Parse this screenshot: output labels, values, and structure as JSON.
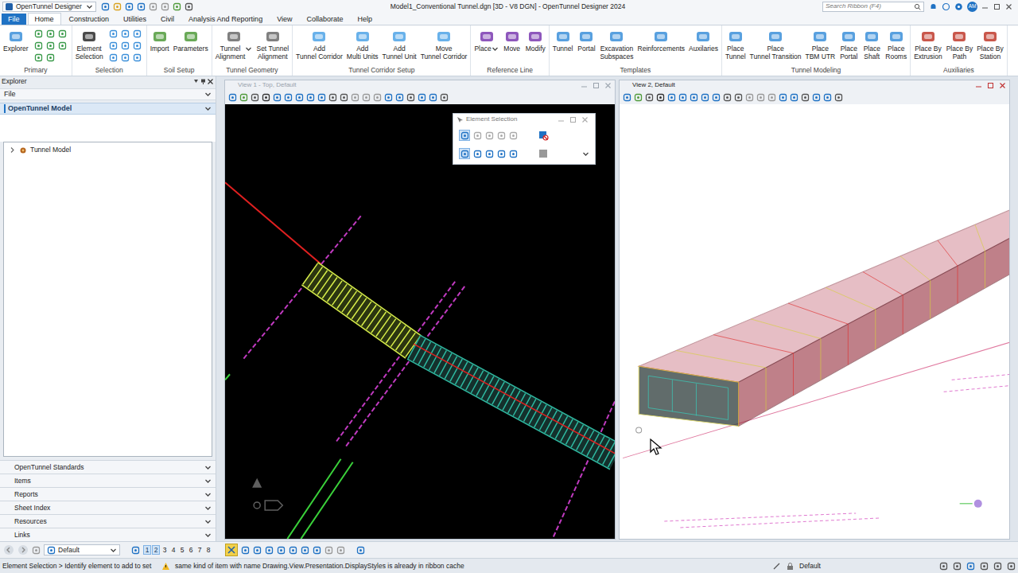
{
  "app": {
    "name": "OpenTunnel Designer",
    "title": "Model1_Conventional Tunnel.dgn [3D - V8 DGN] - OpenTunnel Designer 2024",
    "search_placeholder": "Search Ribbon (F4)",
    "user": "AM"
  },
  "ribbon_tabs": [
    {
      "label": "File",
      "selected": false,
      "kind": "file"
    },
    {
      "label": "Home",
      "selected": true,
      "kind": "tab"
    },
    {
      "label": "Construction",
      "selected": false,
      "kind": "tab"
    },
    {
      "label": "Utilities",
      "selected": false,
      "kind": "tab"
    },
    {
      "label": "Civil",
      "selected": false,
      "kind": "tab"
    },
    {
      "label": "Analysis And Reporting",
      "selected": false,
      "kind": "tab"
    },
    {
      "label": "View",
      "selected": false,
      "kind": "tab"
    },
    {
      "label": "Collaborate",
      "selected": false,
      "kind": "tab"
    },
    {
      "label": "Help",
      "selected": false,
      "kind": "tab"
    }
  ],
  "ribbon_groups": [
    {
      "label": "Primary",
      "buttons": [
        {
          "label": "Explorer",
          "dropdown": false
        }
      ],
      "small_icons": 8
    },
    {
      "label": "Selection",
      "buttons": [
        {
          "label": "Element\nSelection",
          "dropdown": false
        }
      ],
      "small_icons": 9
    },
    {
      "label": "Soil Setup",
      "buttons": [
        {
          "label": "Import",
          "dropdown": false
        },
        {
          "label": "Parameters",
          "dropdown": false
        }
      ],
      "small_icons": 0
    },
    {
      "label": "Tunnel Geometry",
      "buttons": [
        {
          "label": "Tunnel\nAlignment",
          "dropdown": true
        },
        {
          "label": "Set Tunnel\nAlignment",
          "dropdown": false
        }
      ],
      "small_icons": 0
    },
    {
      "label": "Tunnel Corridor Setup",
      "buttons": [
        {
          "label": "Add\nTunnel Corridor",
          "dropdown": false
        },
        {
          "label": "Add\nMulti Units",
          "dropdown": false
        },
        {
          "label": "Add\nTunnel Unit",
          "dropdown": false
        },
        {
          "label": "Move\nTunnel Corridor",
          "dropdown": false
        }
      ],
      "small_icons": 0
    },
    {
      "label": "Reference Line",
      "buttons": [
        {
          "label": "Place",
          "dropdown": true
        },
        {
          "label": "Move",
          "dropdown": false
        },
        {
          "label": "Modify",
          "dropdown": false
        }
      ],
      "small_icons": 0
    },
    {
      "label": "Templates",
      "buttons": [
        {
          "label": "Tunnel",
          "dropdown": false
        },
        {
          "label": "Portal",
          "dropdown": false
        },
        {
          "label": "Excavation\nSubspaces",
          "dropdown": false
        },
        {
          "label": "Reinforcements",
          "dropdown": false
        },
        {
          "label": "Auxilaries",
          "dropdown": false
        }
      ],
      "small_icons": 0
    },
    {
      "label": "Tunnel Modeling",
      "buttons": [
        {
          "label": "Place\nTunnel",
          "dropdown": false
        },
        {
          "label": "Place\nTunnel Transition",
          "dropdown": false
        },
        {
          "label": "Place\nTBM UTR",
          "dropdown": false
        },
        {
          "label": "Place\nPortal",
          "dropdown": false
        },
        {
          "label": "Place\nShaft",
          "dropdown": false
        },
        {
          "label": "Place\nRooms",
          "dropdown": false
        }
      ],
      "small_icons": 0
    },
    {
      "label": "Auxiliaries",
      "buttons": [
        {
          "label": "Place By\nExtrusion",
          "dropdown": false
        },
        {
          "label": "Place By\nPath",
          "dropdown": false
        },
        {
          "label": "Place By\nStation",
          "dropdown": false
        }
      ],
      "small_icons": 0
    }
  ],
  "explorer": {
    "title": "Explorer",
    "top_sections": [
      {
        "label": "File",
        "expanded": false,
        "selected": false
      },
      {
        "label": "OpenTunnel Model",
        "expanded": true,
        "selected": true
      }
    ],
    "tree": [
      {
        "label": "Tunnel Model",
        "expanded": false
      }
    ],
    "bottom_sections": [
      {
        "label": "OpenTunnel Standards",
        "expanded": false
      },
      {
        "label": "Items",
        "expanded": false
      },
      {
        "label": "Reports",
        "expanded": false
      },
      {
        "label": "Sheet Index",
        "expanded": false
      },
      {
        "label": "Resources",
        "expanded": false
      },
      {
        "label": "Links",
        "expanded": false
      }
    ]
  },
  "views": [
    {
      "title": "View 1 - Top, Default",
      "active": false,
      "color": "#000000"
    },
    {
      "title": "View 2, Default",
      "active": true,
      "color": "#ffffff"
    }
  ],
  "element_selection": {
    "title": "Element Selection"
  },
  "bottom_toolbar": {
    "level": "Default",
    "view_buttons": [
      {
        "label": "1",
        "selected": true
      },
      {
        "label": "2",
        "selected": true
      },
      {
        "label": "3",
        "selected": false
      },
      {
        "label": "4",
        "selected": false
      },
      {
        "label": "5",
        "selected": false
      },
      {
        "label": "6",
        "selected": false
      },
      {
        "label": "7",
        "selected": false
      },
      {
        "label": "8",
        "selected": false
      }
    ]
  },
  "status_bar": {
    "prompt": "Element Selection > Identify element to add to set",
    "message": "same kind of item with name Drawing.View.Presentation.DisplayStyles is already in ribbon cache",
    "level": "Default"
  }
}
